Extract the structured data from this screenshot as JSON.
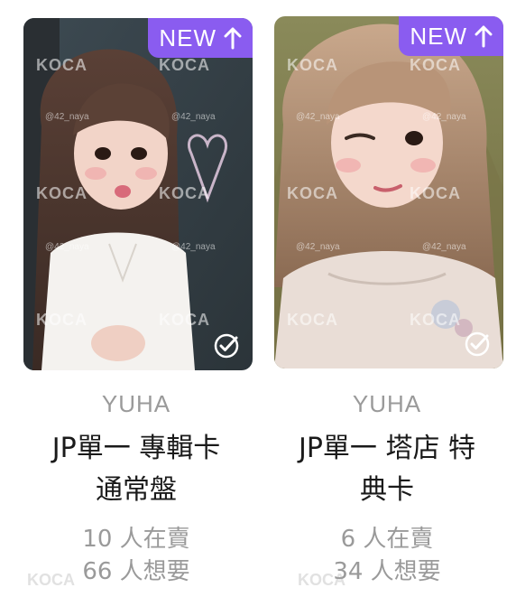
{
  "cards": [
    {
      "badge": "NEW",
      "badge_icon": "arrow-up-icon",
      "member": "YUHA",
      "title_line1": "JP單一 專輯卡",
      "title_line2": "通常盤",
      "selling": "10 人在賣",
      "wanting": "66 人想要",
      "watermark": "KOCA",
      "handle": "@42_naya",
      "check_icon": "check-circle-icon"
    },
    {
      "badge": "NEW",
      "badge_icon": "arrow-up-icon",
      "member": "YUHA",
      "title_line1": "JP單一 塔店 特",
      "title_line2": "典卡",
      "selling": "6 人在賣",
      "wanting": "34 人想要",
      "watermark": "KOCA",
      "handle": "@42_naya",
      "check_icon": "check-circle-icon"
    }
  ],
  "colors": {
    "badge": "#8a5cf0",
    "muted_text": "#9a9a9a",
    "title_text": "#1a1a1a"
  }
}
